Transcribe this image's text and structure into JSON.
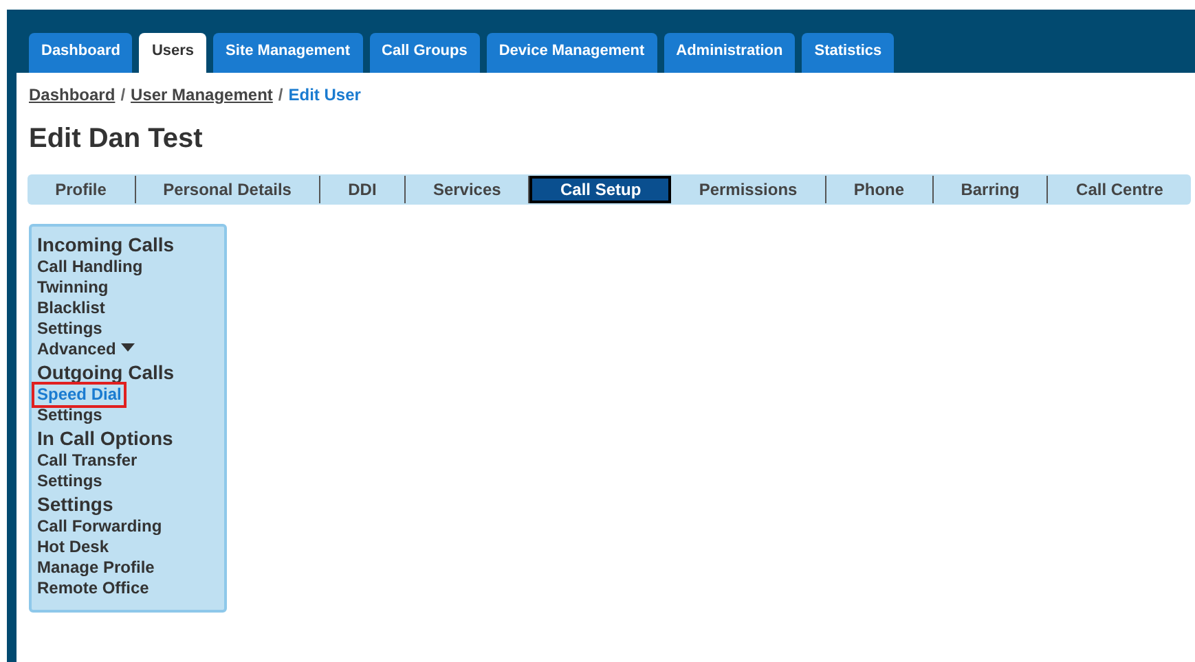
{
  "main_tabs": [
    {
      "label": "Dashboard",
      "selected": false
    },
    {
      "label": "Users",
      "selected": true
    },
    {
      "label": "Site Management",
      "selected": false
    },
    {
      "label": "Call Groups",
      "selected": false
    },
    {
      "label": "Device Management",
      "selected": false
    },
    {
      "label": "Administration",
      "selected": false
    },
    {
      "label": "Statistics",
      "selected": false
    }
  ],
  "breadcrumb": [
    {
      "label": "Dashboard",
      "kind": "link"
    },
    {
      "label": "/",
      "kind": "separator"
    },
    {
      "label": "User Management",
      "kind": "link"
    },
    {
      "label": "/",
      "kind": "separator"
    },
    {
      "label": "Edit User",
      "kind": "current"
    }
  ],
  "title": "Edit Dan Test",
  "sub_tabs": [
    {
      "label": "Profile",
      "selected": false
    },
    {
      "label": "Personal Details",
      "selected": false
    },
    {
      "label": "DDI",
      "selected": false
    },
    {
      "label": "Services",
      "selected": false
    },
    {
      "label": "Call Setup",
      "selected": true
    },
    {
      "label": "Permissions",
      "selected": false
    },
    {
      "label": "Phone",
      "selected": false
    },
    {
      "label": "Barring",
      "selected": false
    },
    {
      "label": "Call Centre",
      "selected": false
    }
  ],
  "sidebar": [
    {
      "heading": "Incoming Calls",
      "items": [
        {
          "label": "Call Handling",
          "selected": false
        },
        {
          "label": "Twinning",
          "selected": false
        },
        {
          "label": "Blacklist",
          "selected": false
        },
        {
          "label": "Settings",
          "selected": false
        },
        {
          "label": "Advanced",
          "selected": false,
          "expandable": true
        }
      ]
    },
    {
      "heading": "Outgoing Calls",
      "items": [
        {
          "label": "Speed Dial",
          "selected": true
        },
        {
          "label": "Settings",
          "selected": false
        }
      ]
    },
    {
      "heading": "In Call Options",
      "items": [
        {
          "label": "Call Transfer",
          "selected": false
        },
        {
          "label": "Settings",
          "selected": false
        }
      ]
    },
    {
      "heading": "Settings",
      "items": [
        {
          "label": "Call Forwarding",
          "selected": false
        },
        {
          "label": "Hot Desk",
          "selected": false
        },
        {
          "label": "Manage Profile",
          "selected": false
        },
        {
          "label": "Remote Office",
          "selected": false
        }
      ]
    }
  ]
}
